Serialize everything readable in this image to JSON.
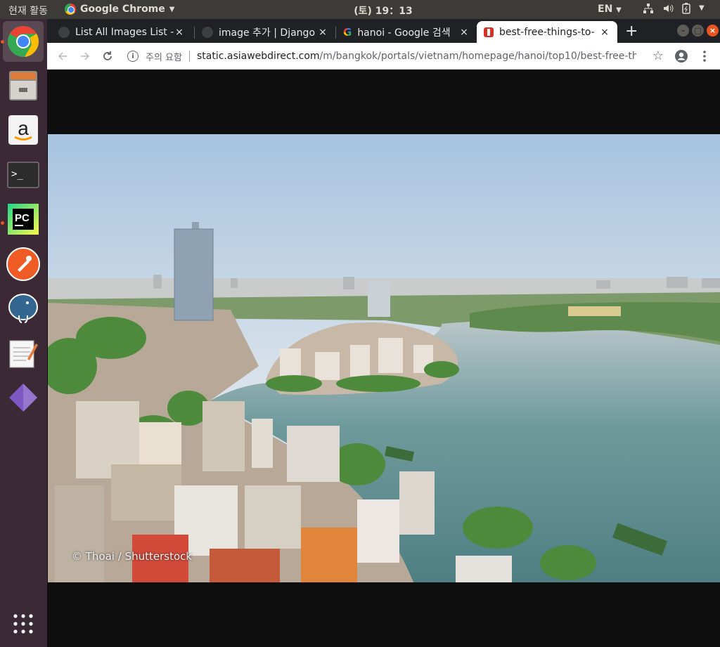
{
  "topbar": {
    "activities": "현재 활동",
    "app_name": "Google Chrome",
    "clock": "(토) 19：13",
    "lang": "EN"
  },
  "dock": {
    "items": [
      {
        "name": "Google Chrome",
        "icon": "chrome-icon"
      },
      {
        "name": "Files",
        "icon": "file-cabinet-icon"
      },
      {
        "name": "Amazon",
        "icon": "amazon-icon"
      },
      {
        "name": "Terminal",
        "icon": "terminal-icon"
      },
      {
        "name": "PyCharm",
        "icon": "pycharm-icon"
      },
      {
        "name": "Postman",
        "icon": "postman-icon"
      },
      {
        "name": "pgAdmin",
        "icon": "postgresql-elephant-icon"
      },
      {
        "name": "Text Editor",
        "icon": "notepad-icon"
      },
      {
        "name": "Unknown App",
        "icon": "purple-diamond-icon"
      },
      {
        "name": "Show Applications",
        "icon": "app-grid-icon"
      }
    ]
  },
  "tabs": [
    {
      "title": "List All Images List -",
      "close": "×",
      "icon": "blank-favicon"
    },
    {
      "title": "image 추가 | Django",
      "close": "×",
      "icon": "blank-favicon"
    },
    {
      "title": "hanoi - Google 검색",
      "close": "×",
      "icon": "google-favicon"
    },
    {
      "title": "best-free-things-to-",
      "close": "×",
      "icon": "site-favicon"
    }
  ],
  "toolbar": {
    "security_label": "주의 요함",
    "url_host": "static.asiawebdirect.com",
    "url_path": "/m/bangkok/portals/vietnam/homepage/hanoi/top10/best-free-things-t..."
  },
  "page": {
    "photo_credit": "© Thoai / Shutterstock"
  }
}
